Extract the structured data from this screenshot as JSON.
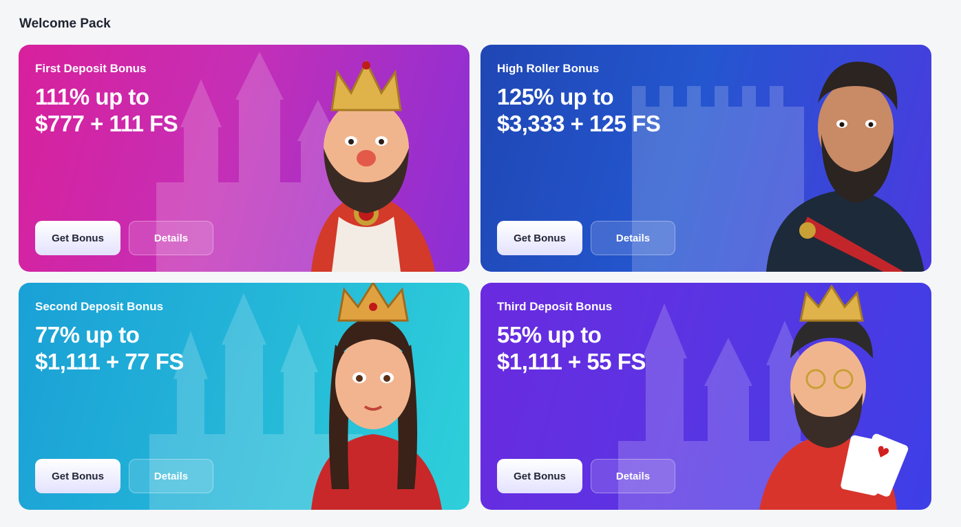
{
  "section": {
    "title": "Welcome Pack"
  },
  "cards": [
    {
      "label": "First Deposit Bonus",
      "offer_line1": "111% up to",
      "offer_line2": "$777 + 111 FS",
      "get_label": "Get Bonus",
      "details_label": "Details",
      "character": "king-icon"
    },
    {
      "label": "High Roller Bonus",
      "offer_line1": "125% up to",
      "offer_line2": "$3,333 + 125 FS",
      "get_label": "Get Bonus",
      "details_label": "Details",
      "character": "general-icon"
    },
    {
      "label": "Second Deposit Bonus",
      "offer_line1": "77% up to",
      "offer_line2": "$1,111 + 77 FS",
      "get_label": "Get Bonus",
      "details_label": "Details",
      "character": "queen-icon"
    },
    {
      "label": "Third Deposit Bonus",
      "offer_line1": "55% up to",
      "offer_line2": "$1,111 + 55 FS",
      "get_label": "Get Bonus",
      "details_label": "Details",
      "character": "card-king-icon"
    }
  ],
  "colors": {
    "card1": "#d8209c",
    "card2": "#1f47b4",
    "card3": "#1aa0d6",
    "card4": "#6a2ae0"
  }
}
